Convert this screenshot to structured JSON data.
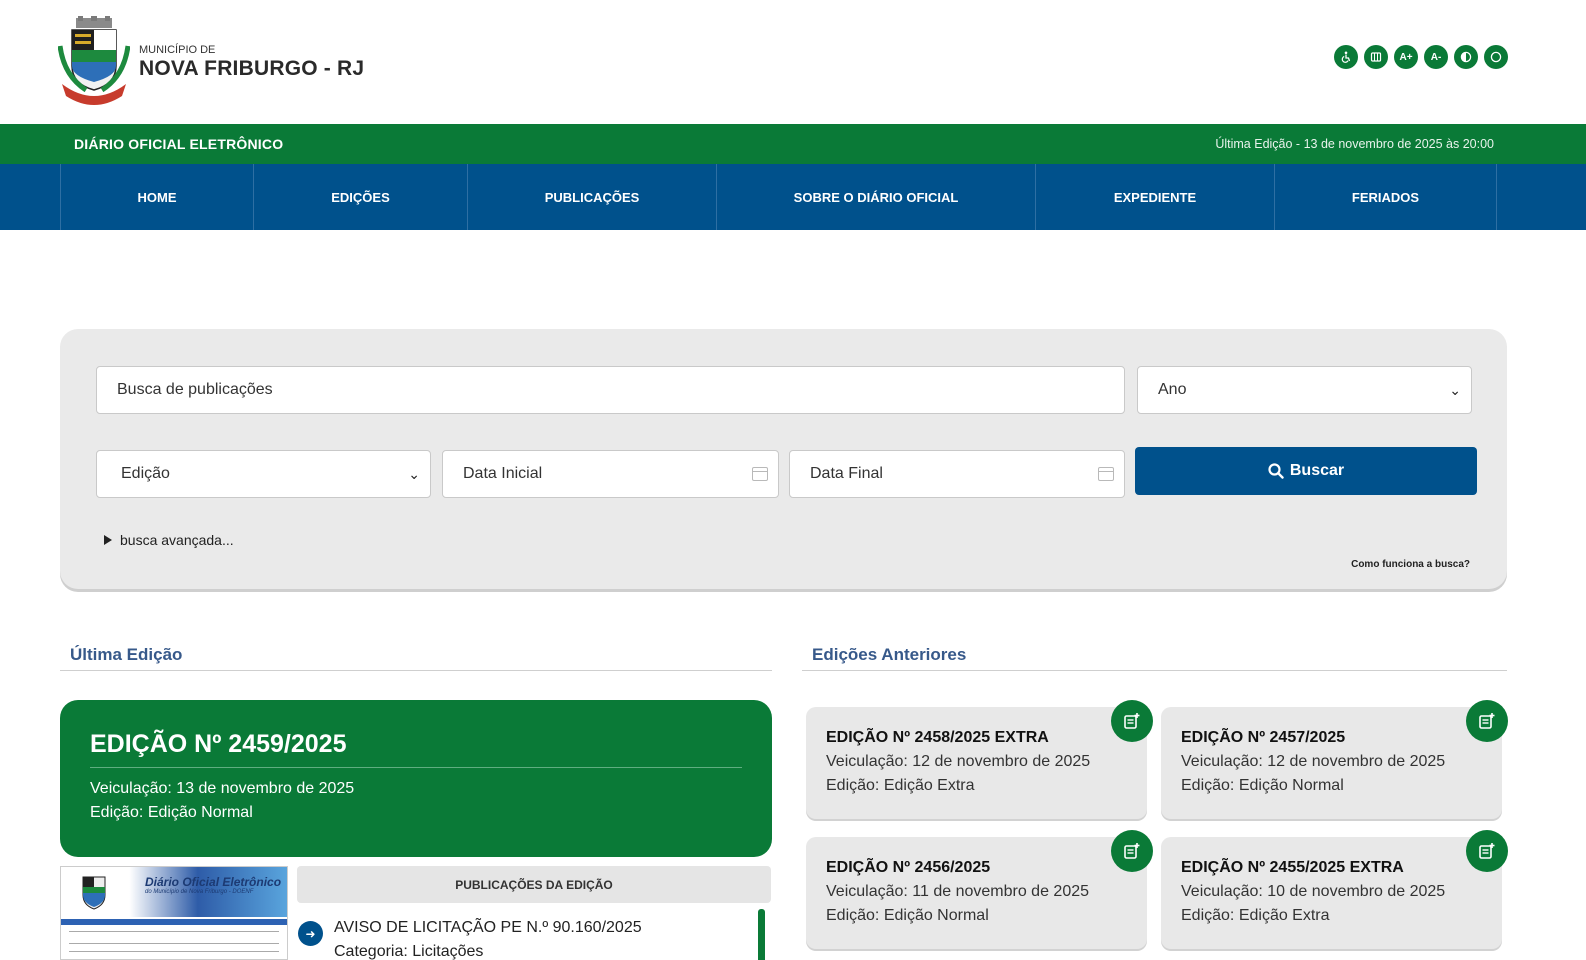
{
  "header": {
    "municipality_small": "MUNICÍPIO DE",
    "municipality_name": "NOVA FRIBURGO - RJ",
    "accessibility_buttons": [
      {
        "icon": "wheelchair-icon",
        "label": ""
      },
      {
        "icon": "sign-language-icon",
        "label": ""
      },
      {
        "icon": "font-increase-icon",
        "label": "A+"
      },
      {
        "icon": "font-decrease-icon",
        "label": "A-"
      },
      {
        "icon": "contrast-icon",
        "label": ""
      },
      {
        "icon": "circle-icon",
        "label": ""
      }
    ]
  },
  "greenbar": {
    "title": "DIÁRIO OFICIAL ELETRÔNICO",
    "last_edition": "Última Edição - 13 de novembro de 2025 às 20:00"
  },
  "nav": {
    "items": [
      "HOME",
      "EDIÇÕES",
      "PUBLICAÇÕES",
      "SOBRE O DIÁRIO OFICIAL",
      "EXPEDIENTE",
      "FERIADOS"
    ]
  },
  "search": {
    "query_placeholder": "Busca de publicações",
    "year_select": "Ano",
    "edition_select": "Edição",
    "start_date_placeholder": "Data Inicial",
    "end_date_placeholder": "Data Final",
    "button_label": "Buscar",
    "advanced_label": "busca avançada...",
    "how_it_works": "Como funciona a busca?"
  },
  "sections": {
    "latest_heading": "Última Edição",
    "previous_heading": "Edições Anteriores"
  },
  "latest_edition": {
    "title": "EDIÇÃO Nº 2459/2025",
    "veiculacao": "Veiculação: 13 de novembro de 2025",
    "edicao": "Edição: Edição Normal"
  },
  "thumbnail": {
    "title": "Diário Oficial Eletrônico",
    "subtitle": "do Município de Nova Friburgo - DOENF"
  },
  "publications": {
    "heading": "PUBLICAÇÕES DA EDIÇÃO",
    "items": [
      {
        "title": "AVISO DE LICITAÇÃO PE N.º 90.160/2025",
        "category": "Categoria: Licitações"
      }
    ]
  },
  "previous_editions": [
    {
      "title": "EDIÇÃO Nº 2458/2025 EXTRA",
      "veiculacao": "Veiculação: 12 de novembro de 2025",
      "edicao": "Edição: Edição Extra"
    },
    {
      "title": "EDIÇÃO Nº 2457/2025",
      "veiculacao": "Veiculação: 12 de novembro de 2025",
      "edicao": "Edição: Edição Normal"
    },
    {
      "title": "EDIÇÃO Nº 2456/2025",
      "veiculacao": "Veiculação: 11 de novembro de 2025",
      "edicao": "Edição: Edição Normal"
    },
    {
      "title": "EDIÇÃO Nº 2455/2025 EXTRA",
      "veiculacao": "Veiculação: 10 de novembro de 2025",
      "edicao": "Edição: Edição Extra"
    }
  ],
  "colors": {
    "green": "#0a7a37",
    "blue": "#00518c",
    "panel_gray": "#eaeaea"
  }
}
